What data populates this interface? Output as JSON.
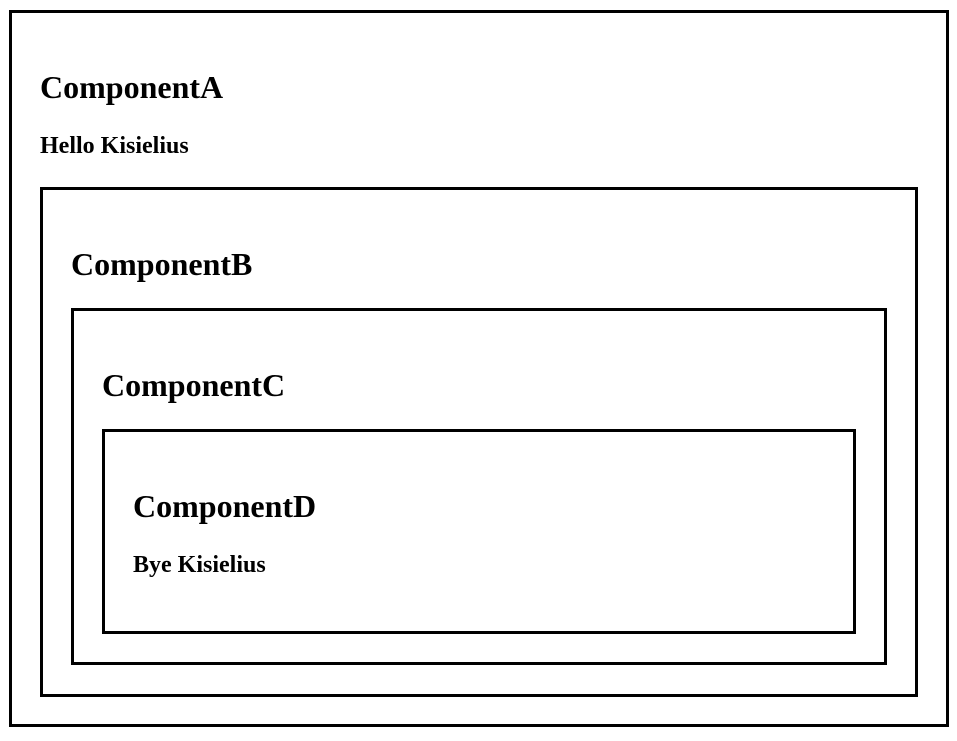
{
  "componentA": {
    "title": "ComponentA",
    "message": "Hello Kisielius",
    "componentB": {
      "title": "ComponentB",
      "componentC": {
        "title": "ComponentC",
        "componentD": {
          "title": "ComponentD",
          "message": "Bye Kisielius"
        }
      }
    }
  },
  "colors": {
    "border": "#000000",
    "background": "#ffffff",
    "text": "#000000"
  }
}
